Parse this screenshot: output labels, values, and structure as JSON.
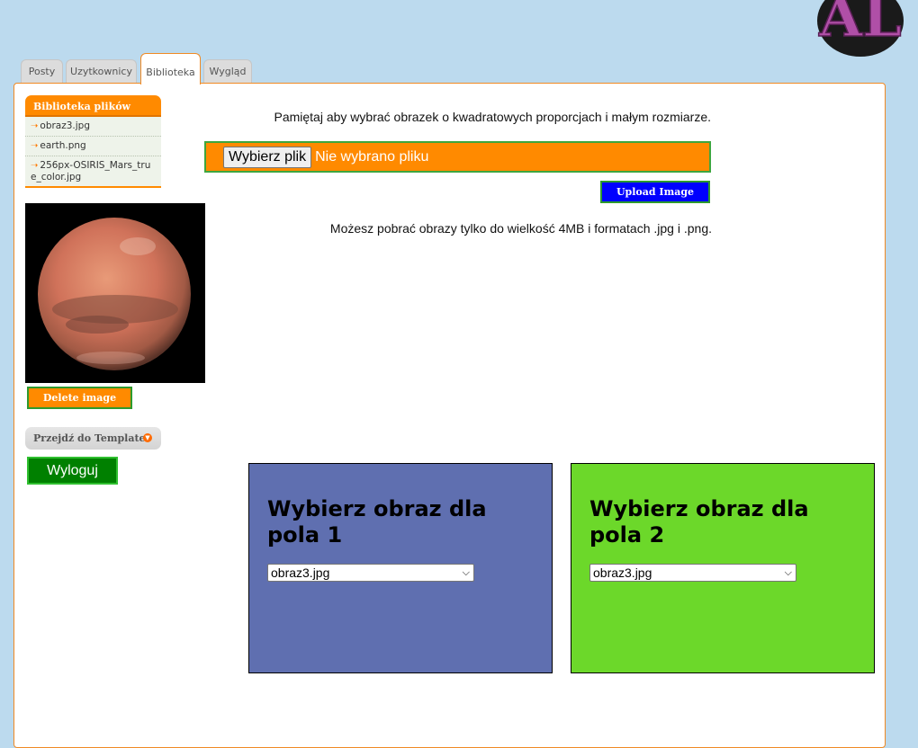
{
  "tabs": [
    {
      "label": "Posty"
    },
    {
      "label": "Uzytkownicy"
    },
    {
      "label": "Biblioteka"
    },
    {
      "label": "Wygląd"
    }
  ],
  "sidebar": {
    "library_title": "Biblioteka plików",
    "files": [
      "obraz3.jpg",
      "earth.png",
      "256px-OSIRIS_Mars_true_color.jpg"
    ],
    "delete_label": "Delete image",
    "template_label": "Przejdź do Template",
    "logout_label": "Wyloguj"
  },
  "upload": {
    "hint": "Pamiętaj aby wybrać obrazek o kwadratowych proporcjach i małym rozmiarze.",
    "choose_file_label": "Wybierz plik",
    "no_file_label": "Nie wybrano pliku",
    "upload_label": "Upload Image",
    "limit_text": "Możesz pobrać obrazy tylko do wielkość 4MB i formatach .jpg i .png."
  },
  "fields": [
    {
      "title": "Wybierz obraz dla pola 1",
      "selected": "obraz3.jpg",
      "color": "#5f6fb0"
    },
    {
      "title": "Wybierz obraz dla pola 2",
      "selected": "obraz3.jpg",
      "color": "#6cd82a"
    }
  ],
  "colors": {
    "accent_orange": "#ff8a00",
    "upload_blue": "#0000ff",
    "logout_green": "#008000",
    "page_bg": "#bcdaee"
  }
}
